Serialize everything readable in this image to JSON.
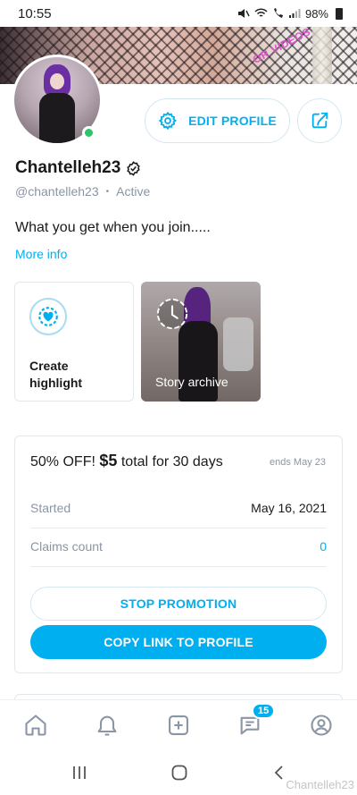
{
  "status_bar": {
    "time": "10:55",
    "battery": "98%"
  },
  "cover": {
    "overlay_text": "OR VIDEOS"
  },
  "profile": {
    "display_name": "Chantelleh23",
    "handle": "@chantelleh23",
    "status": "Active",
    "bio": "What you get when you join.....",
    "more_info": "More info"
  },
  "header_actions": {
    "edit_profile": "EDIT PROFILE",
    "edit_icon": "gear-icon",
    "share_icon": "share-icon"
  },
  "highlights": {
    "create": {
      "label_line1": "Create",
      "label_line2": "highlight",
      "icon": "heart-plus-icon"
    },
    "archive": {
      "label": "Story archive",
      "icon": "history-clock-icon"
    }
  },
  "promotion": {
    "title_prefix": "50% OFF!",
    "price": "$5",
    "title_suffix": "total for 30 days",
    "ends": "ends May 23",
    "started_label": "Started",
    "started_value": "May 16, 2021",
    "claims_label": "Claims count",
    "claims_value": "0",
    "stop_button": "STOP PROMOTION",
    "copy_button": "COPY LINK TO PROFILE"
  },
  "bottom_nav": {
    "items": [
      "home-icon",
      "bell-icon",
      "plus-square-icon",
      "message-icon",
      "profile-icon"
    ],
    "messages_badge": "15"
  },
  "watermark": "Chantelleh23",
  "colors": {
    "accent": "#00aff0",
    "muted": "#8a96a3",
    "online": "#2fc36b",
    "text": "#1a1a1a"
  }
}
